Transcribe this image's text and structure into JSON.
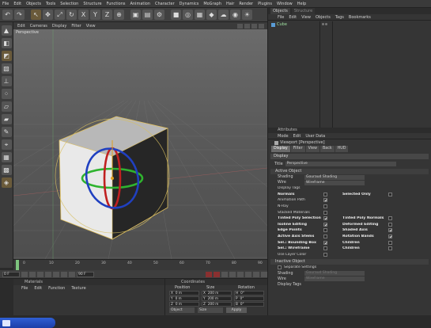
{
  "menubar": [
    "File",
    "Edit",
    "Objects",
    "Tools",
    "Selection",
    "Structure",
    "Functions",
    "Animation",
    "Character",
    "Dynamics",
    "MoGraph",
    "Hair",
    "Render",
    "Plugins",
    "Window",
    "Help"
  ],
  "viewport": {
    "menu": [
      "Edit",
      "Cameras",
      "Display",
      "Filter",
      "View"
    ],
    "label": "Perspective"
  },
  "timeline": {
    "ticks": [
      "0",
      "10",
      "20",
      "30",
      "40",
      "50",
      "60",
      "70",
      "80",
      "90"
    ],
    "start_field": "0 F",
    "end_field": "90 F"
  },
  "materials": {
    "title": "Materials",
    "menu": [
      "File",
      "Edit",
      "Function",
      "Texture"
    ]
  },
  "coordinates": {
    "title": "Coordinates",
    "headers": [
      "Position",
      "Size",
      "Rotation"
    ],
    "rows": [
      [
        "X",
        "0 m",
        "X",
        "200 m",
        "H",
        "0°"
      ],
      [
        "Y",
        "0 m",
        "Y",
        "200 m",
        "P",
        "0°"
      ],
      [
        "Z",
        "0 m",
        "Z",
        "200 m",
        "B",
        "0°"
      ]
    ],
    "object_select": "Object",
    "size_select": "Size",
    "apply": "Apply"
  },
  "object_manager": {
    "tabs": [
      "Objects",
      "Structure"
    ],
    "menu": [
      "File",
      "Edit",
      "View",
      "Objects",
      "Tags",
      "Bookmarks"
    ],
    "items": [
      {
        "name": "Cube"
      }
    ]
  },
  "attributes": {
    "title": "Attributes",
    "menu": [
      "Mode",
      "Edit",
      "User Data"
    ],
    "object_line": "Viewport [Perspective]",
    "tabs": [
      "Display",
      "Filter",
      "View",
      "Back",
      "HUD"
    ],
    "section": "Display",
    "title_label": "Title",
    "title_value": "Perspective",
    "active_object": "Active Object",
    "shading_label": "Shading",
    "shading_value": "Gouraud Shading",
    "wire_label": "Wire",
    "wire_value": "Wireframe",
    "checks": [
      {
        "left": "Display Tags",
        "left_on": false,
        "left_box": false
      },
      {
        "left": "Normals",
        "left_on": false,
        "left_bold": true,
        "right": "Selected Only",
        "right_on": false,
        "right_bold": true
      },
      {
        "left": "Animation Path",
        "left_on": true
      },
      {
        "left": "N-Ray",
        "left_on": false
      },
      {
        "left": "Stacked Materials",
        "left_on": false
      },
      {
        "left": "Tinted Poly Selection",
        "left_on": true,
        "left_bold": true,
        "right": "Tinted Poly Normals",
        "right_on": false,
        "right_bold": true
      },
      {
        "left": "Isoline Editing",
        "left_on": true,
        "left_bold": true,
        "right": "Deformed Editing",
        "right_on": false,
        "right_bold": true
      },
      {
        "left": "Edge Points",
        "left_on": false,
        "left_bold": true,
        "right": "Shaded Axis",
        "right_on": true,
        "right_bold": true
      },
      {
        "left": "Active Axis Stems",
        "left_on": false,
        "left_bold": true,
        "right": "Rotation Bands",
        "right_on": true,
        "right_bold": true
      },
      {
        "left": "Sel.: Bounding Box",
        "left_on": true,
        "left_bold": true,
        "right": "Children",
        "right_on": false,
        "right_bold": true
      },
      {
        "left": "Sel.: Wireframe",
        "left_on": false,
        "left_bold": true,
        "right": "Children",
        "right_on": false,
        "right_bold": true
      },
      {
        "left": "Use Layer Color",
        "left_on": false
      }
    ],
    "inactive_object": "Inactive Object",
    "gpu_label": "Separate Settings",
    "shading2_label": "Shading",
    "shading2_value": "Gouraud Shading",
    "wire2_label": "Wire",
    "wire2_value": "Wireframe",
    "display_tags2": "Display Tags"
  }
}
